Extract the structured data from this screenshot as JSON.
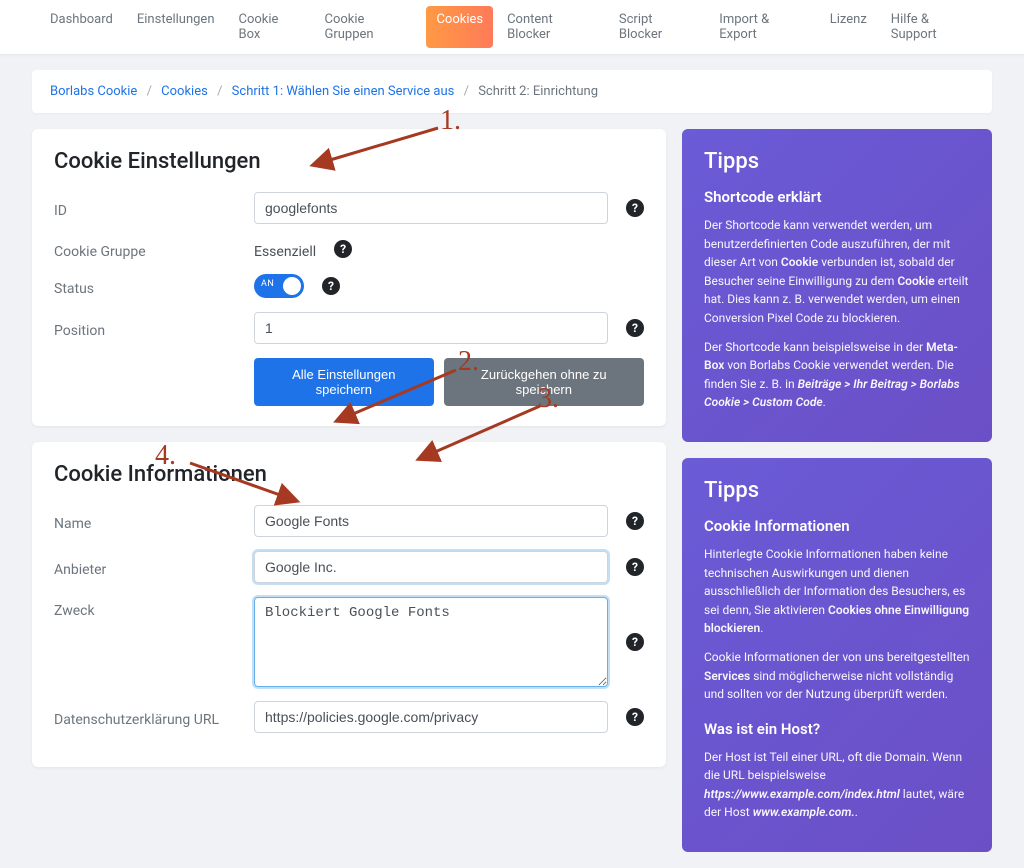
{
  "nav": {
    "tabs": [
      {
        "label": "Dashboard"
      },
      {
        "label": "Einstellungen"
      },
      {
        "label": "Cookie Box"
      },
      {
        "label": "Cookie Gruppen"
      },
      {
        "label": "Cookies",
        "active": true
      },
      {
        "label": "Content Blocker"
      },
      {
        "label": "Script Blocker"
      },
      {
        "label": "Import & Export"
      },
      {
        "label": "Lizenz"
      },
      {
        "label": "Hilfe & Support"
      }
    ]
  },
  "breadcrumb": {
    "parts": [
      "Borlabs Cookie",
      "Cookies",
      "Schritt 1: Wählen Sie einen Service aus",
      "Schritt 2: Einrichtung"
    ]
  },
  "settings": {
    "title": "Cookie Einstellungen",
    "id_label": "ID",
    "id_value": "googlefonts",
    "group_label": "Cookie Gruppe",
    "group_value": "Essenziell",
    "status_label": "Status",
    "status_on": "AN",
    "position_label": "Position",
    "position_value": "1",
    "save_label": "Alle Einstellungen speichern",
    "cancel_label": "Zurückgehen ohne zu speichern"
  },
  "info": {
    "title": "Cookie Informationen",
    "name_label": "Name",
    "name_value": "Google Fonts",
    "provider_label": "Anbieter",
    "provider_value": "Google Inc.",
    "purpose_label": "Zweck",
    "purpose_value": "Blockiert Google Fonts",
    "privacy_label": "Datenschutzerklärung URL",
    "privacy_value": "https://policies.google.com/privacy"
  },
  "tips1": {
    "title": "Tipps",
    "h1": "Shortcode erklärt",
    "p1a": "Der Shortcode kann verwendet werden, um benutzerdefinierten Code auszuführen, der mit dieser Art von ",
    "p1b": "Cookie",
    "p1c": " verbunden ist, sobald der Besucher seine Einwilligung zu dem ",
    "p1d": "Cookie",
    "p1e": " erteilt hat. Dies kann z. B. verwendet werden, um einen Conversion Pixel Code zu blockieren.",
    "p2a": "Der Shortcode kann beispielsweise in der ",
    "p2b": "Meta-Box",
    "p2c": " von Borlabs Cookie verwendet werden. Die finden Sie z. B. in ",
    "p2d": "Beiträge > Ihr Beitrag > Borlabs Cookie > Custom Code",
    "p2e": "."
  },
  "tips2": {
    "title": "Tipps",
    "h1": "Cookie Informationen",
    "p1a": "Hinterlegte Cookie Informationen haben keine technischen Auswirkungen und dienen ausschließlich der Information des Besuchers, es sei denn, Sie aktivieren ",
    "p1b": "Cookies ohne Einwilligung blockieren",
    "p1c": ".",
    "p2a": "Cookie Informationen der von uns bereitgestellten ",
    "p2b": "Services",
    "p2c": " sind möglicherweise nicht vollständig und sollten vor der Nutzung überprüft werden.",
    "h2": "Was ist ein Host?",
    "p3a": "Der Host ist Teil einer URL, oft die Domain. Wenn die URL beispielsweise ",
    "p3b": "https://www.example.com/index.html",
    "p3c": " lautet, wäre der Host ",
    "p3d": "www.example.com.",
    "p3e": "."
  },
  "annotations": {
    "a1": "1.",
    "a2": "2.",
    "a3": "3.",
    "a4": "4."
  }
}
